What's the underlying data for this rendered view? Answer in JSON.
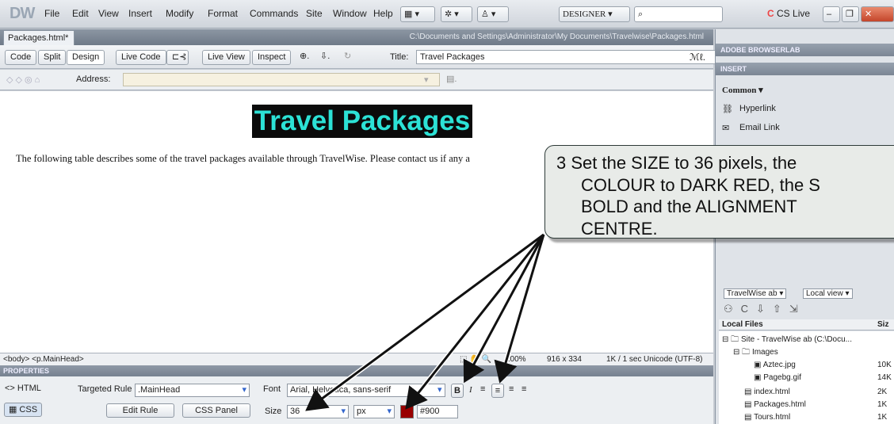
{
  "app": {
    "logo": "DW"
  },
  "menu": [
    "File",
    "Edit",
    "View",
    "Insert",
    "Modify",
    "Format",
    "Commands",
    "Site",
    "Window",
    "Help"
  ],
  "workspace": "DESIGNER",
  "cslive": "CS Live",
  "doc": {
    "tab": "Packages.html*",
    "path": "C:\\Documents and Settings\\Administrator\\My Documents\\Travelwise\\Packages.html",
    "views": {
      "code": "Code",
      "split": "Split",
      "design": "Design",
      "livecode": "Live Code",
      "liveview": "Live View",
      "inspect": "Inspect"
    },
    "title_label": "Title:",
    "title_value": "Travel Packages",
    "address_label": "Address:",
    "heading": "Travel Packages",
    "paragraph": "The following table describes some of the travel packages available through TravelWise. Please contact us if any a"
  },
  "status": {
    "tags": "<body> <p.MainHead>",
    "zoom": "100%",
    "dims": "916 x 334",
    "size": "1K / 1 sec",
    "encoding": "Unicode (UTF-8)"
  },
  "properties": {
    "header": "PROPERTIES",
    "html": "HTML",
    "css": "CSS",
    "targeted_rule_label": "Targeted Rule",
    "targeted_rule": ".MainHead",
    "edit_rule": "Edit Rule",
    "css_panel": "CSS Panel",
    "font_label": "Font",
    "font_value": "Arial, Helvetica, sans-serif",
    "size_label": "Size",
    "size_value": "36",
    "size_unit": "px",
    "color_value": "#900",
    "color_swatch": "#990000"
  },
  "right_panel": {
    "browserlab": "ADOBE BROWSERLAB",
    "insert": "INSERT",
    "category": "Common",
    "items": [
      "Hyperlink",
      "Email Link"
    ],
    "files_site": "TravelWise ab",
    "files_view": "Local view",
    "local_files": "Local Files",
    "size_col": "Siz",
    "tree": [
      {
        "name": "Site - TravelWise ab (C:\\Docu...",
        "size": ""
      },
      {
        "name": "Images",
        "size": ""
      },
      {
        "name": "Aztec.jpg",
        "size": "10K"
      },
      {
        "name": "Pagebg.gif",
        "size": "14K"
      },
      {
        "name": "index.html",
        "size": "2K"
      },
      {
        "name": "Packages.html",
        "size": "1K"
      },
      {
        "name": "Tours.html",
        "size": "1K"
      }
    ]
  },
  "callout": {
    "line1": "3  Set the SIZE to 36 pixels, the",
    "line2": "COLOUR to DARK RED, the S",
    "line3": "BOLD and the ALIGNMENT",
    "line4": "CENTRE."
  }
}
